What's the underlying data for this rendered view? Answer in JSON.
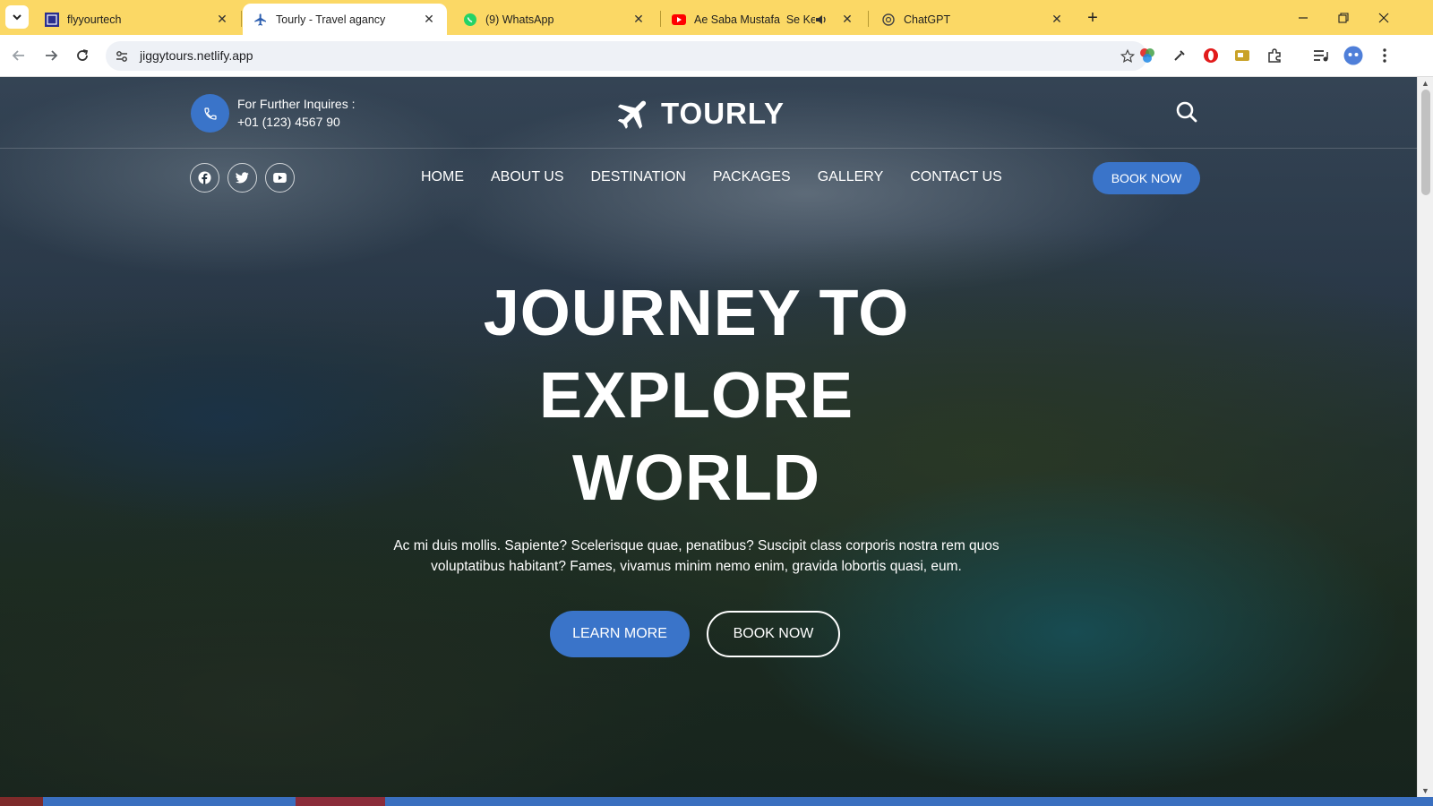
{
  "browser": {
    "tabs": [
      {
        "title": "flyyourtech",
        "active": false
      },
      {
        "title": "Tourly - Travel agancy",
        "active": true
      },
      {
        "title": "(9) WhatsApp",
        "active": false
      },
      {
        "title": "Ae Saba Mustafa ️ Se Keh",
        "active": false,
        "audio": true
      },
      {
        "title": "ChatGPT",
        "active": false
      }
    ],
    "url": "jiggytours.netlify.app",
    "colors": {
      "tabbar": "#fbd865",
      "toolbar": "#ffffff"
    }
  },
  "header": {
    "inquiry_label": "For Further Inquires :",
    "phone": "+01 (123) 4567 90",
    "logo_text": "TOURLY",
    "social": [
      "facebook-icon",
      "twitter-icon",
      "youtube-icon"
    ],
    "nav": [
      "HOME",
      "ABOUT US",
      "DESTINATION",
      "PACKAGES",
      "GALLERY",
      "CONTACT US"
    ],
    "book_button": "BOOK NOW"
  },
  "hero": {
    "title_lines": [
      "JOURNEY TO",
      "EXPLORE",
      "WORLD"
    ],
    "description": "Ac mi duis mollis. Sapiente? Scelerisque quae, penatibus? Suscipit class corporis nostra rem quos voluptatibus habitant? Fames, vivamus minim nemo enim, gravida lobortis quasi, eum.",
    "learn_more": "LEARN MORE",
    "book_now": "BOOK NOW"
  },
  "colors": {
    "accent": "#3a74c9"
  }
}
